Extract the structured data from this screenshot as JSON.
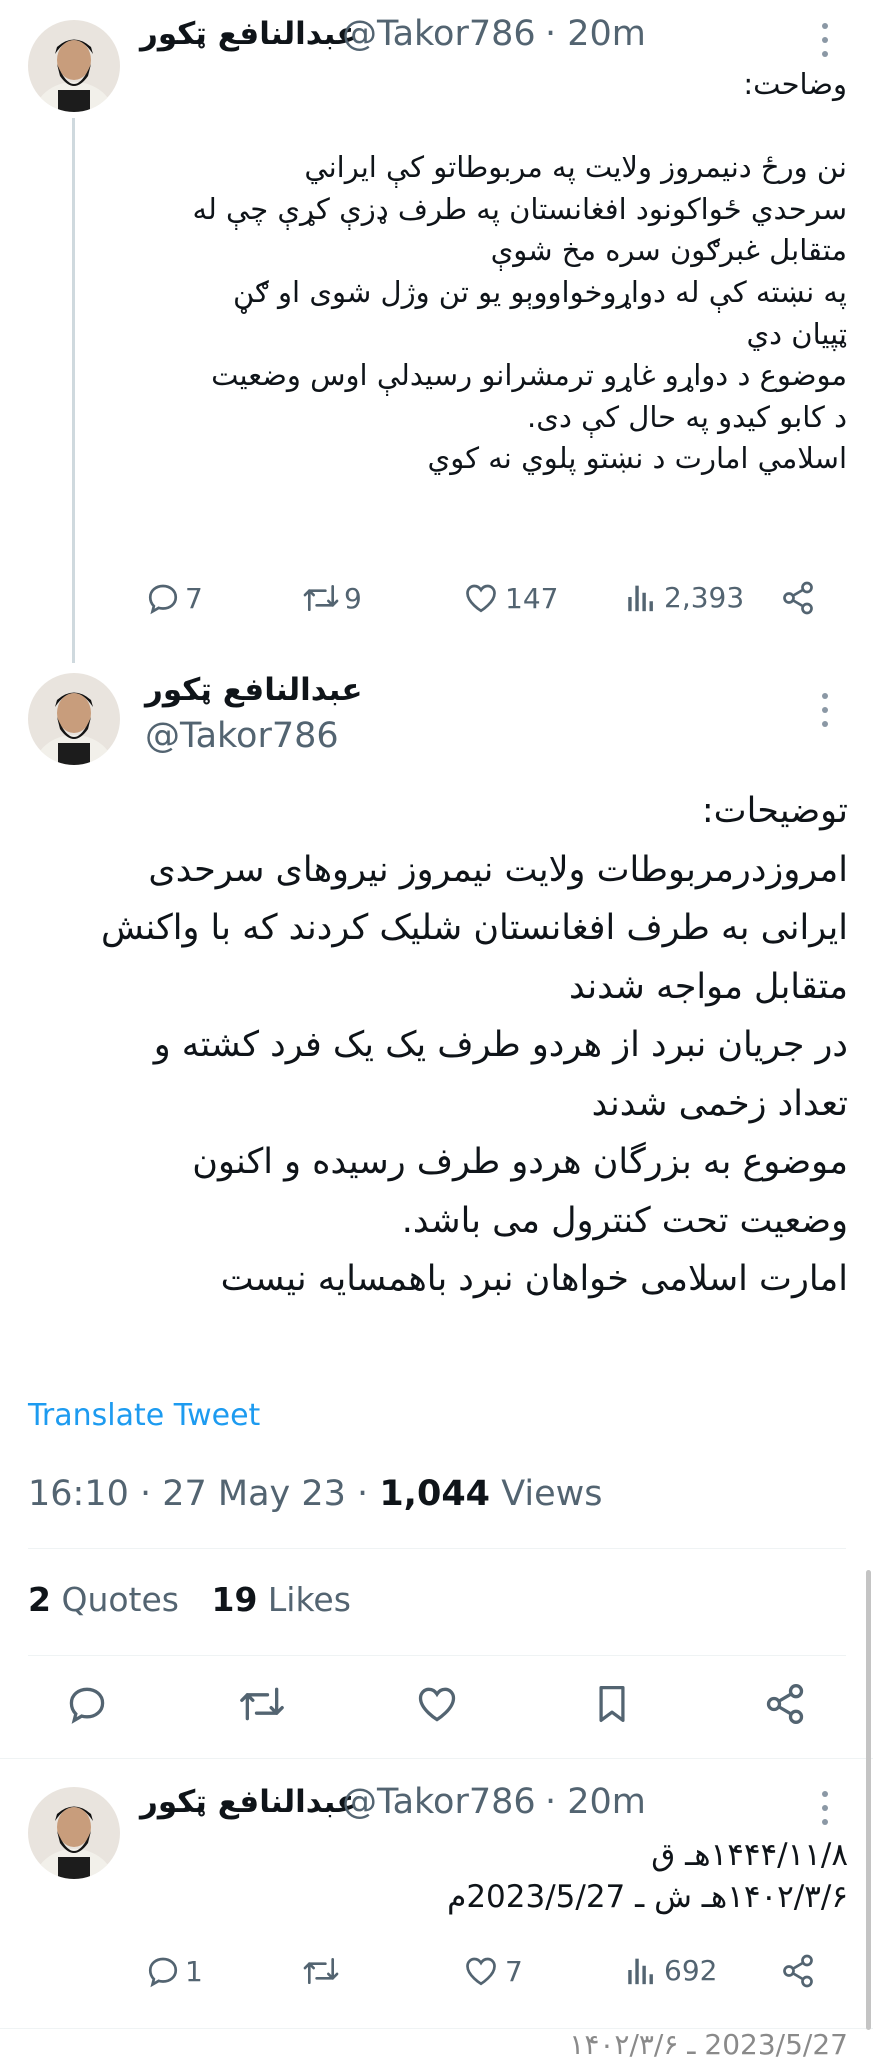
{
  "tweet1": {
    "author_name": "عبدالنافع ټکور",
    "handle": "@Takor786",
    "time": "· 20m",
    "lines": [
      "وضاحت:",
      "",
      "نن ورځ دنیمروز ولایت په مربوطاتو کې ایراني",
      "سرحدي ځواکونود افغانستان په طرف ډزې کړې چې له",
      "متقابل غبرګون سره مخ شوې",
      "په نښته کې له دواړوخواووېو يو تن وژل شوی او ګڼ",
      "ټپيان دي",
      "موضوع د دواړو غاړو ترمشرانو رسيدلې اوس وضعيت",
      "د کابو کیدو په حال کې دی.",
      "اسلامي امارت د نښتو پلوي نه کوي"
    ],
    "replies": "7",
    "retweets": "9",
    "likes": "147",
    "views": "2,393"
  },
  "main": {
    "author_name": "عبدالنافع ټکور",
    "handle": "@Takor786",
    "lines": [
      "توضیحات:",
      "امروزدرمربوطات ولایت نیمروز نیروهای سرحدی",
      "ایرانی به طرف افغانستان شلیک کردند که با واکنش",
      "متقابل مواجه شدند",
      "در جریان نبرد از هردو طرف یک یک فرد کشته و",
      "تعداد زخمی شدند",
      "موضوع به بزرگان هردو طرف رسیده و اکنون",
      "وضعیت تحت کنترول می باشد.",
      "امارت اسلامی خواهان نبرد باهمسایه نیست"
    ],
    "translate": "Translate Tweet",
    "timestamp": "16:10 · 27 May 23 ·",
    "views_count": "1,044",
    "views_label": "Views",
    "quotes_count": "2",
    "quotes_label": "Quotes",
    "likes_count": "19",
    "likes_label": "Likes"
  },
  "tweet3": {
    "author_name": "عبدالنافع ټکور",
    "handle": "@Takor786",
    "time": "· 20m",
    "lines": [
      "۱۴۴۴/۱۱/۸هـ ق",
      "۱۴۰۲/۳/۶هـ ش ـ 2023/5/27م"
    ],
    "replies": "1",
    "likes": "7",
    "views": "692"
  },
  "partial_bottom_text": "2023/5/27 ـ ۱۴۰۲/۳/۶"
}
